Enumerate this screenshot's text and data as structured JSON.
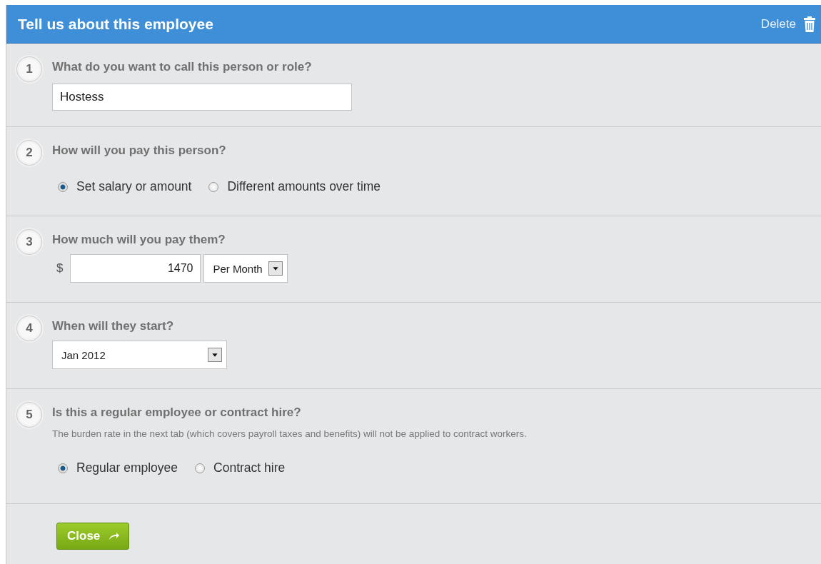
{
  "header": {
    "title": "Tell us about this employee",
    "delete_label": "Delete"
  },
  "steps": [
    {
      "number": "1",
      "kind": "text",
      "question": "What do you want to call this person or role?",
      "value": "Hostess"
    },
    {
      "number": "2",
      "kind": "radio",
      "question": "How will you pay this person?",
      "options": [
        {
          "label": "Set salary or amount",
          "selected": true
        },
        {
          "label": "Different amounts over time",
          "selected": false
        }
      ]
    },
    {
      "number": "3",
      "kind": "amount",
      "question": "How much will you pay them?",
      "currency": "$",
      "value": "1470",
      "period": "Per Month"
    },
    {
      "number": "4",
      "kind": "select",
      "question": "When will they start?",
      "value": "Jan 2012"
    },
    {
      "number": "5",
      "kind": "radio",
      "question": "Is this a regular employee or contract hire?",
      "note": "The burden rate in the next tab (which covers payroll taxes and benefits) will not be applied to contract workers.",
      "options": [
        {
          "label": "Regular employee",
          "selected": true
        },
        {
          "label": "Contract hire",
          "selected": false
        }
      ]
    }
  ],
  "close_button": "Close"
}
